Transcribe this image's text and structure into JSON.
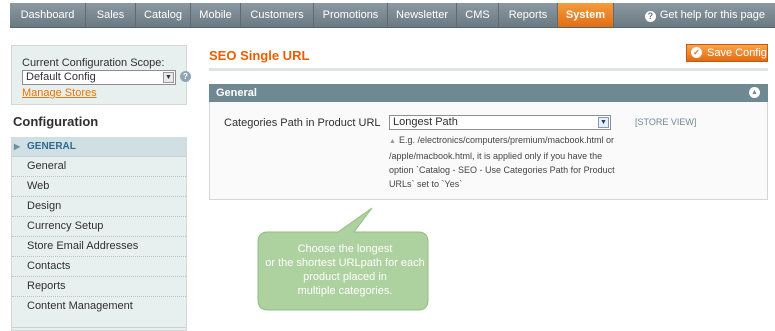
{
  "nav": {
    "items": [
      "Dashboard",
      "Sales",
      "Catalog",
      "Mobile",
      "Customers",
      "Promotions",
      "Newsletter",
      "CMS",
      "Reports",
      "System"
    ],
    "active": "System",
    "help": "Get help for this page"
  },
  "scope": {
    "label": "Current Configuration Scope:",
    "selected": "Default Config",
    "manage_link": "Manage Stores"
  },
  "sidebar": {
    "title": "Configuration",
    "section": "GENERAL",
    "items": [
      "General",
      "Web",
      "Design",
      "Currency Setup",
      "Store Email Addresses",
      "Contacts",
      "Reports",
      "Content Management"
    ]
  },
  "main": {
    "title": "SEO Single URL",
    "save_label": "Save Config",
    "fieldset_title": "General",
    "field": {
      "label": "Categories Path in Product URL",
      "value": "Longest Path",
      "scope": "[STORE VIEW]",
      "note_lines": [
        "E.g. /electronics/computers/premium/macbook.html or",
        "/apple/macbook.html, it is applied only if you have the",
        "option `Catalog - SEO - Use Categories Path for Product",
        "URLs` set to `Yes`"
      ]
    }
  },
  "callout": {
    "lines": [
      "Choose the longest",
      "or the shortest URLpath for each",
      "product placed in",
      "multiple categories."
    ]
  },
  "colors": {
    "accent": "#eb5e00",
    "nav_bg": "#7b8a92",
    "callout": "#a9cf9a"
  }
}
